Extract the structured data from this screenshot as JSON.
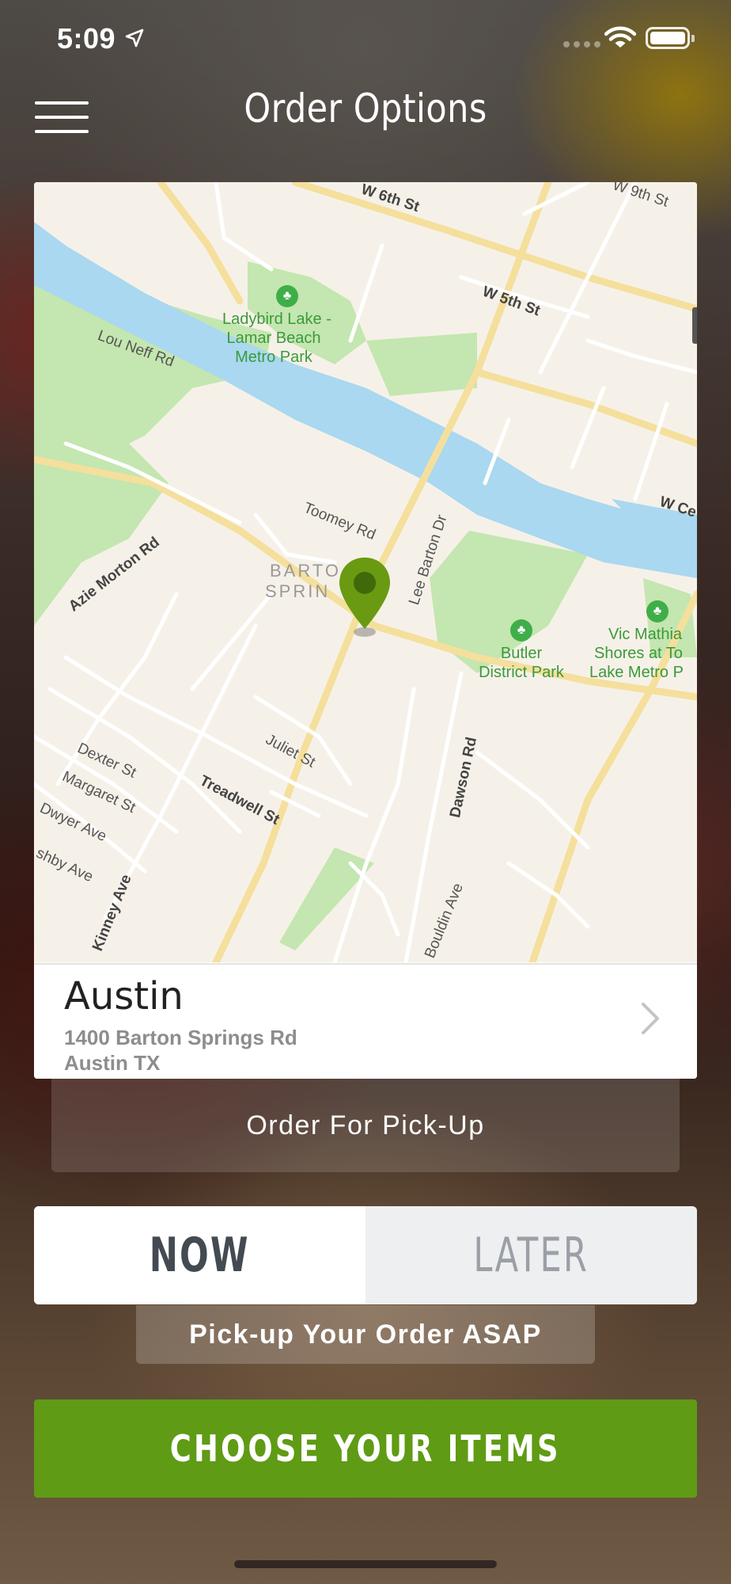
{
  "status_bar": {
    "time": "5:09"
  },
  "header": {
    "title": "Order Options",
    "menu_icon": "hamburger-menu-icon"
  },
  "map": {
    "labels": {
      "w6th": "W 6th St",
      "w9th": "W 9th St",
      "w5th": "W 5th St",
      "wce": "W Ce",
      "ladybird": "Ladybird Lake -",
      "lamar": "Lamar Beach",
      "metro_park": "Metro Park",
      "lou_neff": "Lou Neff Rd",
      "toomey": "Toomey Rd",
      "barton": "BARTO",
      "springs": "SPRIN",
      "lee_barton": "Lee Barton Dr",
      "azie": "Azie Morton Rd",
      "butler1": "Butler",
      "butler2": "District Park",
      "vic1": "Vic Mathia",
      "vic2": "Shores at To",
      "vic3": "Lake Metro P",
      "dexter": "Dexter St",
      "margaret": "Margaret St",
      "dwyer": "Dwyer Ave",
      "ashby": "shby Ave",
      "juliet": "Juliet St",
      "treadwell": "Treadwell St",
      "dawson": "Dawson Rd",
      "kinney": "Kinney Ave",
      "bouldin": "Bouldin Ave"
    }
  },
  "location": {
    "name": "Austin",
    "address_line1": "1400 Barton Springs Rd",
    "address_line2": "Austin TX"
  },
  "order_type": {
    "label": "Order For Pick-Up"
  },
  "time_toggle": {
    "now": "NOW",
    "later": "LATER",
    "selected": "NOW"
  },
  "time_hint": "Pick-up Your Order ASAP",
  "cta": {
    "label": "CHOOSE YOUR ITEMS"
  },
  "colors": {
    "accent_green": "#5f9b14",
    "pin_green": "#6a9a12",
    "water": "#a9d8f0",
    "park": "#c4e6b0"
  }
}
